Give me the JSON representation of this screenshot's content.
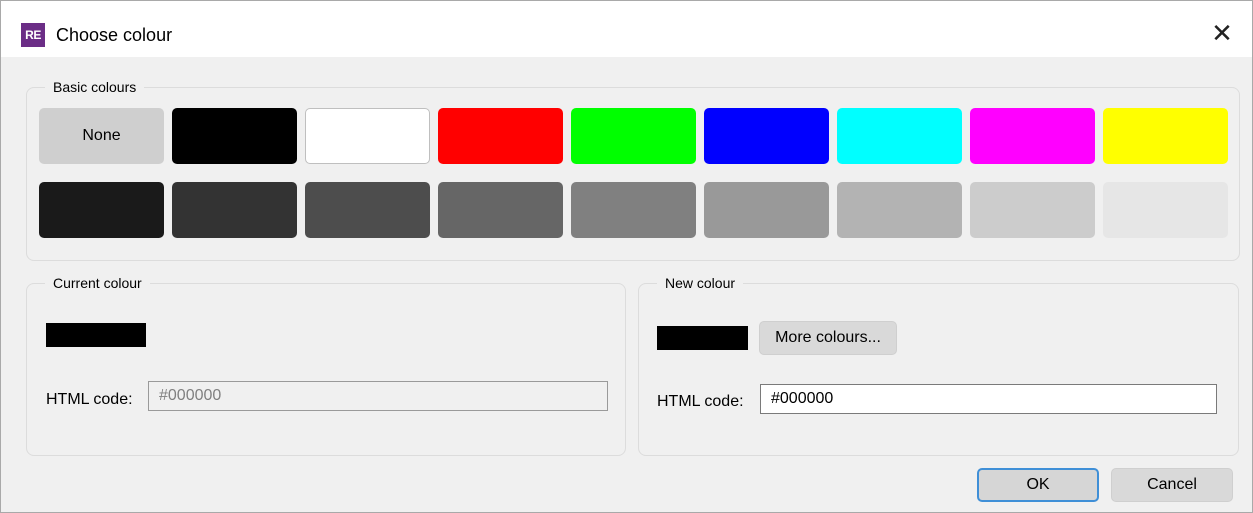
{
  "window": {
    "app_icon_text": "RE",
    "title": "Choose colour",
    "close_glyph": "✕"
  },
  "basic_colours": {
    "label": "Basic colours",
    "none_label": "None",
    "row1": [
      "#000000",
      "#ffffff",
      "#ff0000",
      "#00ff00",
      "#0000ff",
      "#00ffff",
      "#ff00ff",
      "#ffff00"
    ],
    "row2": [
      "#1a1a1a",
      "#333333",
      "#4d4d4d",
      "#666666",
      "#808080",
      "#999999",
      "#b3b3b3",
      "#cccccc",
      "#e6e6e6"
    ]
  },
  "current_colour": {
    "label": "Current colour",
    "preview_color": "#000000",
    "html_code_label": "HTML code:",
    "html_code_value": "#000000"
  },
  "new_colour": {
    "label": "New colour",
    "preview_color": "#000000",
    "more_colours_label": "More colours...",
    "html_code_label": "HTML code:",
    "html_code_value": "#000000"
  },
  "buttons": {
    "ok_label": "OK",
    "cancel_label": "Cancel"
  }
}
